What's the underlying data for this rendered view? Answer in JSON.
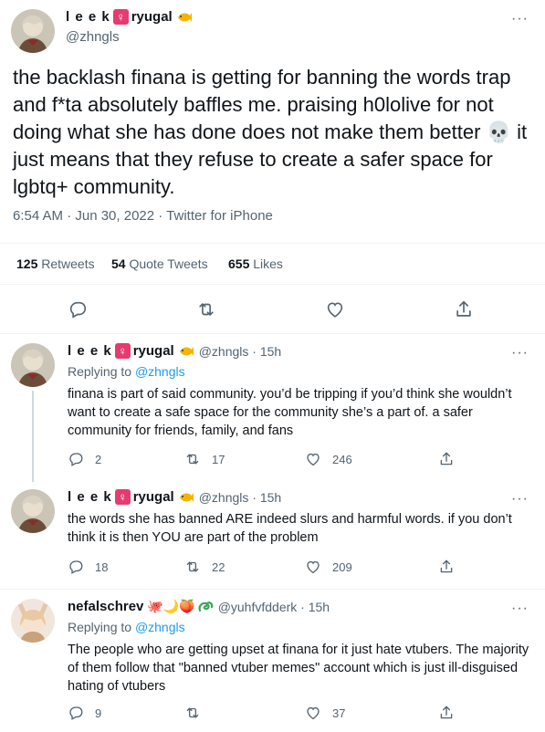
{
  "main": {
    "display_name": "l e e k",
    "badge_symbol": "♀",
    "name_suffix": "ryugal",
    "handle": "@zhngls",
    "more": "···",
    "text": "the backlash finana is getting for banning the words trap and f*ta absolutely baffles me. praising h0lolive for not doing what she has done does not make them better 💀 it just means that they refuse to create a safer space for lgbtq+ community.",
    "timestamp": "6:54 AM · Jun 30, 2022",
    "dot": " · ",
    "source": "Twitter for iPhone",
    "retweets_count": "125",
    "retweets_label": "Retweets",
    "quotes_count": "54",
    "quotes_label": "Quote Tweets",
    "likes_count": "655",
    "likes_label": "Likes"
  },
  "replies": [
    {
      "display_name": "l e e k",
      "badge_symbol": "♀",
      "name_suffix": "ryugal",
      "handle_time": "@zhngls · 15h",
      "replying_prefix": "Replying to",
      "replying_handle": "@zhngls",
      "text": "finana is part of said community. you’d be tripping if you’d think she wouldn’t want to create a safe space for the community she’s a part of. a safer community for friends, family, and fans",
      "reply_count": "2",
      "retweet_count": "17",
      "like_count": "246"
    },
    {
      "display_name": "l e e k",
      "badge_symbol": "♀",
      "name_suffix": "ryugal",
      "handle_time": "@zhngls · 15h",
      "text": "the words she has banned ARE indeed slurs and harmful words. if you don’t think it is then YOU are part of the problem",
      "reply_count": "18",
      "retweet_count": "22",
      "like_count": "209"
    },
    {
      "display_name": "nefalschrev",
      "emoji": "🐙🌙🍑",
      "handle_time": "@yuhfvfdderk · 15h",
      "replying_prefix": "Replying to",
      "replying_handle": "@zhngls",
      "text": "The people who are getting upset at finana for it just hate vtubers. The majority of them follow that \"banned vtuber memes\" account which is just ill-disguised hating of vtubers",
      "reply_count": "9",
      "like_count": "37"
    }
  ],
  "colors": {
    "text": "#0f1419",
    "secondary": "#536471",
    "link": "#1d9bf0",
    "border": "#eff3f4",
    "badge": "#e63b6f"
  },
  "icons": [
    "reply-icon",
    "retweet-icon",
    "like-icon",
    "share-icon",
    "more-icon",
    "fish-emoji-icon",
    "skull-emoji-icon"
  ]
}
